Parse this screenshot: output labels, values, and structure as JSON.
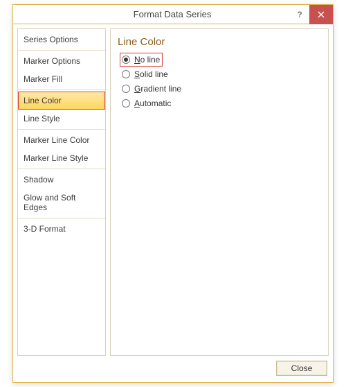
{
  "window": {
    "title": "Format Data Series",
    "help": "?",
    "close": "×"
  },
  "sidebar": {
    "groups": [
      [
        "Series Options"
      ],
      [
        "Marker Options",
        "Marker Fill"
      ],
      [
        "Line Color",
        "Line Style"
      ],
      [
        "Marker Line Color",
        "Marker Line Style"
      ],
      [
        "Shadow",
        "Glow and Soft Edges"
      ],
      [
        "3-D Format"
      ]
    ],
    "selected": "Line Color"
  },
  "content": {
    "heading": "Line Color",
    "options": [
      {
        "key": "no-line",
        "label": "No line",
        "checked": true,
        "highlight": true
      },
      {
        "key": "solid-line",
        "label": "Solid line",
        "checked": false,
        "highlight": false
      },
      {
        "key": "gradient-line",
        "label": "Gradient line",
        "checked": false,
        "highlight": false
      },
      {
        "key": "automatic",
        "label": "Automatic",
        "checked": false,
        "highlight": false
      }
    ]
  },
  "footer": {
    "close_label": "Close"
  }
}
